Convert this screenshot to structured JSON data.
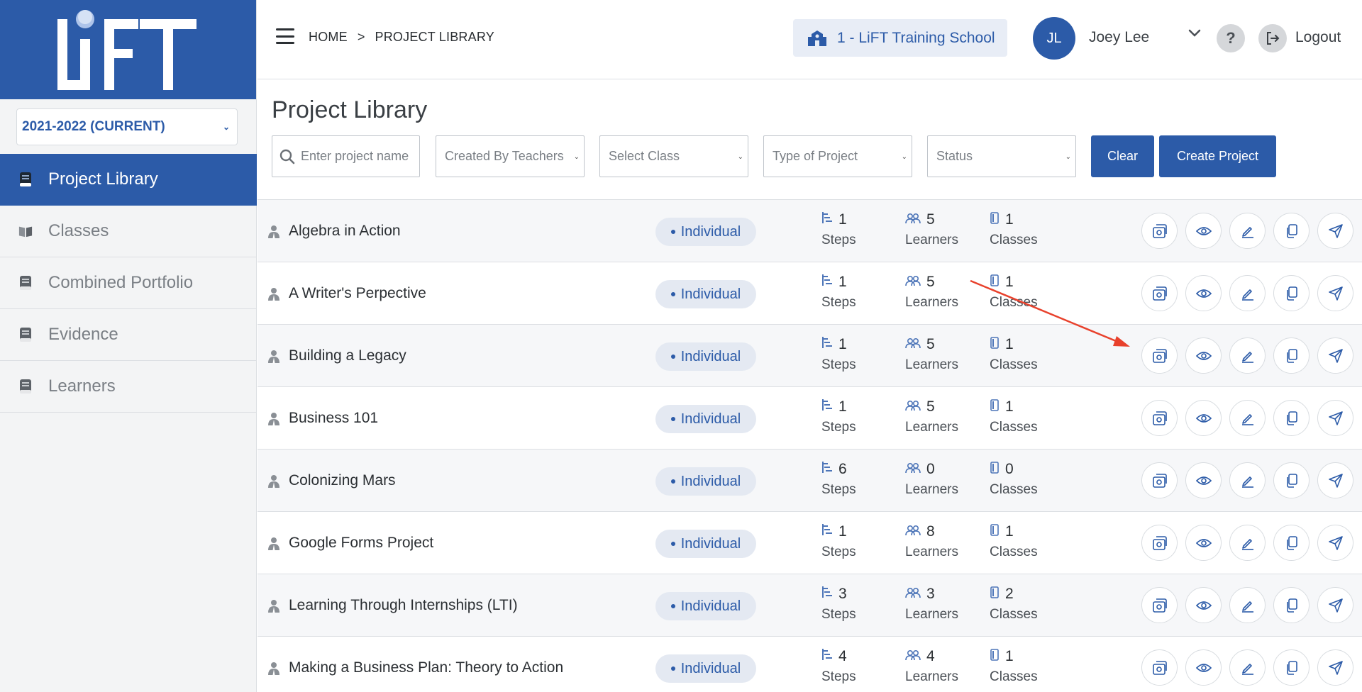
{
  "sidebar": {
    "logo_text": "LiFT",
    "year_selector": "2021-2022 (CURRENT)",
    "items": [
      {
        "label": "Project Library",
        "icon": "book-icon",
        "active": true
      },
      {
        "label": "Classes",
        "icon": "open-book-icon",
        "active": false
      },
      {
        "label": "Combined Portfolio",
        "icon": "notebook-icon",
        "active": false
      },
      {
        "label": "Evidence",
        "icon": "notebook-icon",
        "active": false
      },
      {
        "label": "Learners",
        "icon": "notebook-icon",
        "active": false
      }
    ]
  },
  "header": {
    "breadcrumb": [
      "HOME",
      ">",
      "PROJECT LIBRARY"
    ],
    "school": "1 - LiFT Training School",
    "user_initials": "JL",
    "user_name": "Joey Lee",
    "help_label": "?",
    "logout_label": "Logout"
  },
  "page": {
    "title": "Project Library",
    "filters": {
      "search_placeholder": "Enter project name",
      "created_by": "Created By Teachers",
      "select_class": "Select Class",
      "type_of_project": "Type of Project",
      "status": "Status"
    },
    "clear_label": "Clear",
    "create_label": "Create Project"
  },
  "table": {
    "steps_label": "Steps",
    "learners_label": "Learners",
    "classes_label": "Classes",
    "rows": [
      {
        "name": "Algebra in Action",
        "type": "Individual",
        "steps": "1",
        "learners": "5",
        "classes": "1"
      },
      {
        "name": "A Writer's Perpective",
        "type": "Individual",
        "steps": "1",
        "learners": "5",
        "classes": "1"
      },
      {
        "name": "Building a Legacy",
        "type": "Individual",
        "steps": "1",
        "learners": "5",
        "classes": "1"
      },
      {
        "name": "Business 101",
        "type": "Individual",
        "steps": "1",
        "learners": "5",
        "classes": "1"
      },
      {
        "name": "Colonizing Mars",
        "type": "Individual",
        "steps": "6",
        "learners": "0",
        "classes": "0"
      },
      {
        "name": "Google Forms Project",
        "type": "Individual",
        "steps": "1",
        "learners": "8",
        "classes": "1"
      },
      {
        "name": "Learning Through Internships (LTI)",
        "type": "Individual",
        "steps": "3",
        "learners": "3",
        "classes": "2"
      },
      {
        "name": "Making a Business Plan: Theory to Action",
        "type": "Individual",
        "steps": "4",
        "learners": "4",
        "classes": "1"
      }
    ],
    "action_icons": [
      "portfolio-icon",
      "view-icon",
      "edit-icon",
      "copy-icon",
      "send-icon"
    ]
  },
  "colors": {
    "brand": "#2c5ba8",
    "annotation_arrow": "#e8412c"
  }
}
